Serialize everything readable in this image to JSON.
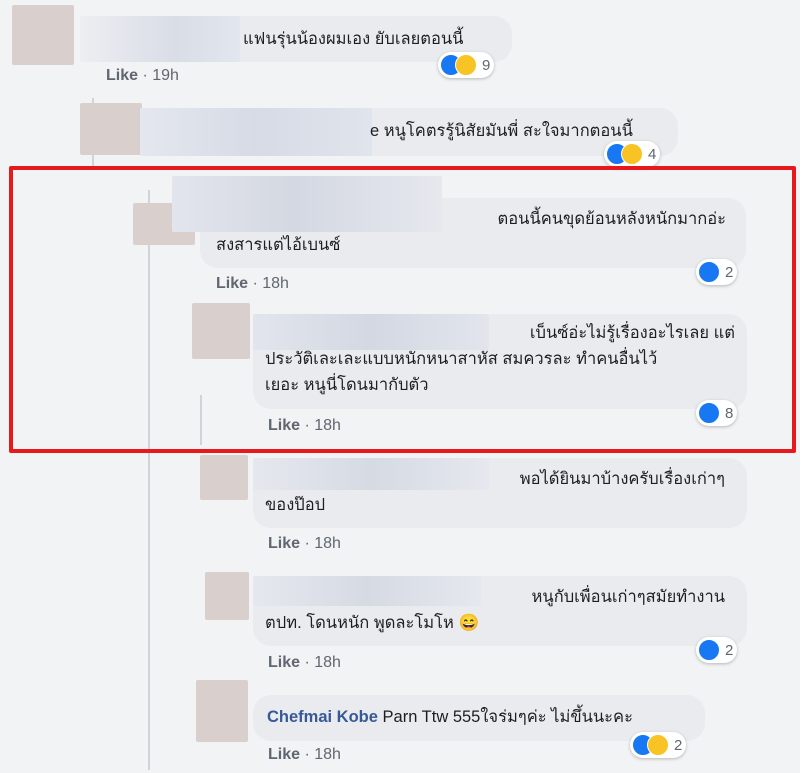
{
  "comments": [
    {
      "id": "c1",
      "text_lines": [
        "แฟนรุ่นน้องผมเอง ยับเลยตอนนี้"
      ],
      "action": "Like",
      "time": "19h",
      "reaction_count": "9",
      "reactions": [
        "like-icon",
        "haha-icon"
      ]
    },
    {
      "id": "c2",
      "text_lines": [
        "e หนูโคตรรู้นิสัยมันพี่ สะใจมากตอนนี้"
      ],
      "action": "Like",
      "time": "19h",
      "reaction_count": "4",
      "reactions": [
        "like-icon",
        "haha-icon"
      ]
    },
    {
      "id": "c3",
      "text_lines": [
        "ตอนนี้คนขุดย้อนหลังหนักมากอ่ะ",
        "สงสารแต่ไอ้เบนซ์"
      ],
      "action": "Like",
      "time": "18h",
      "reaction_count": "2",
      "reactions": [
        "like-icon"
      ]
    },
    {
      "id": "c4",
      "text_lines": [
        "เบ็นซ์อ่ะไม่รู้เรื่องอะไรเลย แต่",
        "ประวัติเละเละแบบหนักหนาสาหัส สมควรละ ทำคนอื่นไว้",
        "เยอะ หนูนี่โดนมากับตัว"
      ],
      "action": "Like",
      "time": "18h",
      "reaction_count": "8",
      "reactions": [
        "like-icon"
      ]
    },
    {
      "id": "c5",
      "text_lines": [
        "พอได้ยินมาบ้างครับเรื่องเก่าๆ",
        "ของป๊อป"
      ],
      "action": "Like",
      "time": "18h"
    },
    {
      "id": "c6",
      "text_lines": [
        "หนูกับเพื่อนเก่าๆสมัยทำงาน",
        "ตปท. โดนหนัก พูดละโมโห 😄"
      ],
      "action": "Like",
      "time": "18h",
      "reaction_count": "2",
      "reactions": [
        "like-icon"
      ]
    },
    {
      "id": "c7",
      "author": "Chefmai Kobe",
      "text": "Parn Ttw 555ใจร่มๆค่ะ ไม่ขึ้นนะคะ",
      "action": "Like",
      "time": "18h",
      "reaction_count": "2",
      "reactions": [
        "like-icon",
        "haha-icon"
      ]
    }
  ],
  "colors": {
    "highlight": "#e8191c",
    "link": "#385898",
    "bubble": "#e9ebee",
    "like": "#1877f2"
  }
}
